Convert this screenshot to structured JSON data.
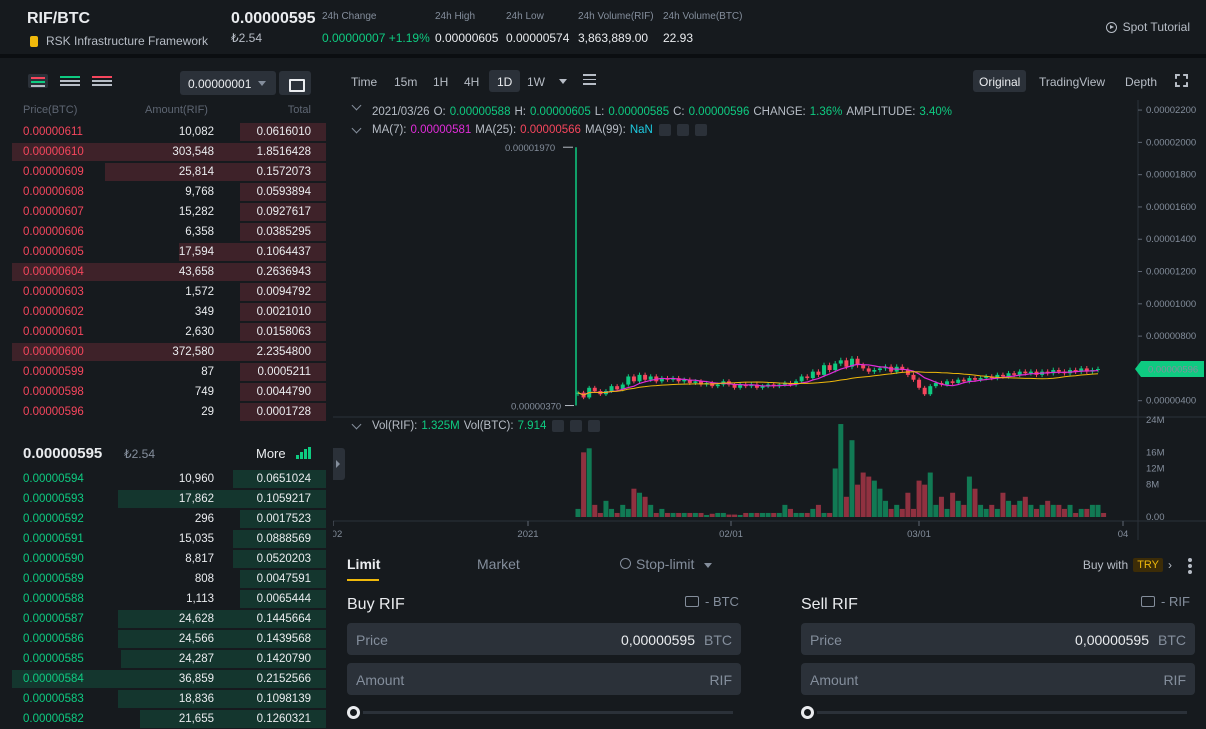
{
  "header": {
    "symbol": "RIF/BTC",
    "name": "RSK Infrastructure Framework",
    "last_price": "0.00000595",
    "last_fiat": "₺2.54",
    "stats": [
      {
        "label": "24h Change",
        "value": "0.00000007 +1.19%",
        "color": "green"
      },
      {
        "label": "24h High",
        "value": "0.00000605",
        "color": "white"
      },
      {
        "label": "24h Low",
        "value": "0.00000574",
        "color": "white"
      },
      {
        "label": "24h Volume(RIF)",
        "value": "3,863,889.00",
        "color": "white"
      },
      {
        "label": "24h Volume(BTC)",
        "value": "22.93",
        "color": "white"
      }
    ],
    "spot_tutorial": "Spot Tutorial"
  },
  "orderbook": {
    "tick_size": "0.00000001",
    "col_price": "Price(BTC)",
    "col_amount": "Amount(RIF)",
    "col_total": "Total",
    "asks": [
      {
        "price": "0.00000611",
        "amount": "10,082",
        "total": "0.0616010",
        "depth": 0.27
      },
      {
        "price": "0.00000610",
        "amount": "303,548",
        "total": "1.8516428",
        "depth": 0.98
      },
      {
        "price": "0.00000609",
        "amount": "25,814",
        "total": "0.1572073",
        "depth": 0.69
      },
      {
        "price": "0.00000608",
        "amount": "9,768",
        "total": "0.0593894",
        "depth": 0.27
      },
      {
        "price": "0.00000607",
        "amount": "15,282",
        "total": "0.0927617",
        "depth": 0.27
      },
      {
        "price": "0.00000606",
        "amount": "6,358",
        "total": "0.0385295",
        "depth": 0.27
      },
      {
        "price": "0.00000605",
        "amount": "17,594",
        "total": "0.1064437",
        "depth": 0.46
      },
      {
        "price": "0.00000604",
        "amount": "43,658",
        "total": "0.2636943",
        "depth": 0.98
      },
      {
        "price": "0.00000603",
        "amount": "1,572",
        "total": "0.0094792",
        "depth": 0.27
      },
      {
        "price": "0.00000602",
        "amount": "349",
        "total": "0.0021010",
        "depth": 0.27
      },
      {
        "price": "0.00000601",
        "amount": "2,630",
        "total": "0.0158063",
        "depth": 0.27
      },
      {
        "price": "0.00000600",
        "amount": "372,580",
        "total": "2.2354800",
        "depth": 0.98
      },
      {
        "price": "0.00000599",
        "amount": "87",
        "total": "0.0005211",
        "depth": 0.27
      },
      {
        "price": "0.00000598",
        "amount": "749",
        "total": "0.0044790",
        "depth": 0.27
      },
      {
        "price": "0.00000596",
        "amount": "29",
        "total": "0.0001728",
        "depth": 0.27
      }
    ],
    "mid_price": "0.00000595",
    "mid_fiat": "₺2.54",
    "more": "More",
    "bids": [
      {
        "price": "0.00000594",
        "amount": "10,960",
        "total": "0.0651024",
        "depth": 0.29
      },
      {
        "price": "0.00000593",
        "amount": "17,862",
        "total": "0.1059217",
        "depth": 0.65
      },
      {
        "price": "0.00000592",
        "amount": "296",
        "total": "0.0017523",
        "depth": 0.27
      },
      {
        "price": "0.00000591",
        "amount": "15,035",
        "total": "0.0888569",
        "depth": 0.29
      },
      {
        "price": "0.00000590",
        "amount": "8,817",
        "total": "0.0520203",
        "depth": 0.29
      },
      {
        "price": "0.00000589",
        "amount": "808",
        "total": "0.0047591",
        "depth": 0.27
      },
      {
        "price": "0.00000588",
        "amount": "1,113",
        "total": "0.0065444",
        "depth": 0.27
      },
      {
        "price": "0.00000587",
        "amount": "24,628",
        "total": "0.1445664",
        "depth": 0.65
      },
      {
        "price": "0.00000586",
        "amount": "24,566",
        "total": "0.1439568",
        "depth": 0.65
      },
      {
        "price": "0.00000585",
        "amount": "24,287",
        "total": "0.1420790",
        "depth": 0.64
      },
      {
        "price": "0.00000584",
        "amount": "36,859",
        "total": "0.2152566",
        "depth": 0.98
      },
      {
        "price": "0.00000583",
        "amount": "18,836",
        "total": "0.1098139",
        "depth": 0.65
      },
      {
        "price": "0.00000582",
        "amount": "21,655",
        "total": "0.1260321",
        "depth": 0.58
      }
    ]
  },
  "chart": {
    "intervals": [
      "Time",
      "15m",
      "1H",
      "4H",
      "1D",
      "1W"
    ],
    "active_interval": "1D",
    "views": [
      "Original",
      "TradingView",
      "Depth"
    ],
    "ohlc": {
      "date": "2021/03/26",
      "o_label": "O:",
      "o": "0.00000588",
      "h_label": "H:",
      "h": "0.00000605",
      "l_label": "L:",
      "l": "0.00000585",
      "c_label": "C:",
      "c": "0.00000596",
      "change_label": "CHANGE:",
      "change": "1.36%",
      "amp_label": "AMPLITUDE:",
      "amp": "3.40%"
    },
    "ma": {
      "ma7_label": "MA(7):",
      "ma7": "0.00000581",
      "ma25_label": "MA(25):",
      "ma25": "0.00000566",
      "ma99_label": "MA(99):",
      "ma99": "NaN"
    },
    "vol": {
      "rif_label": "Vol(RIF):",
      "rif": "1.325M",
      "btc_label": "Vol(BTC):",
      "btc": "7.914"
    },
    "price_axis": [
      "0.00002200",
      "0.00002000",
      "0.00001800",
      "0.00001600",
      "0.00001400",
      "0.00001200",
      "0.00001000",
      "0.00000800",
      "0.00000600",
      "0.00000400"
    ],
    "vol_axis": [
      "24M",
      "16M",
      "12M",
      "8M",
      "0.00"
    ],
    "time_axis": [
      "2/02",
      "2021",
      "02/01",
      "03/01",
      "04"
    ],
    "high_marker": "0.00001970",
    "low_marker": "0.00000370",
    "last_tag": "0.00000596",
    "colors": {
      "up": "#0ecb81",
      "down": "#f6465d",
      "ma7": "#f0b90b",
      "ma25": "#e12cd9"
    }
  },
  "chart_data": {
    "type": "candlestick",
    "title": "",
    "ylabel": "",
    "ylim": [
      3.3e-06,
      2.25e-05
    ],
    "volume_ylim": [
      0,
      24000000
    ],
    "x_ticks": [
      "2/02",
      "2021",
      "02/01",
      "03/01",
      "04"
    ],
    "series": [
      {
        "name": "MA(7)",
        "last": 5.81e-06
      },
      {
        "name": "MA(25)",
        "last": 5.66e-06
      }
    ],
    "extremes": {
      "high": 1.97e-05,
      "low": 3.7e-06,
      "last": 5.96e-06
    },
    "close": [
      4.5e-06,
      4.2e-06,
      4.8e-06,
      4.6e-06,
      4.4e-06,
      4.6e-06,
      4.9e-06,
      4.7e-06,
      5e-06,
      5.5e-06,
      5.2e-06,
      5.6e-06,
      5.3e-06,
      5.5e-06,
      5.2e-06,
      5.4e-06,
      5.3e-06,
      5.4e-06,
      5.2e-06,
      5.3e-06,
      5.1e-06,
      5.2e-06,
      5e-06,
      5.1e-06,
      4.9e-06,
      5e-06,
      5.2e-06,
      5e-06,
      4.8e-06,
      5e-06,
      4.9e-06,
      5e-06,
      4.8e-06,
      4.9e-06,
      5e-06,
      4.9e-06,
      5e-06,
      5.1e-06,
      5e-06,
      5.2e-06,
      5.5e-06,
      5.4e-06,
      5.8e-06,
      5.6e-06,
      6.2e-06,
      5.9e-06,
      6.3e-06,
      6.5e-06,
      6.1e-06,
      6.6e-06,
      6.2e-06,
      6e-06,
      5.8e-06,
      5.9e-06,
      6e-06,
      6.1e-06,
      5.8e-06,
      6.1e-06,
      5.9e-06,
      5.6e-06,
      5.3e-06,
      4.8e-06,
      4.4e-06,
      4.9e-06,
      5.1e-06,
      5e-06,
      5.2e-06,
      5.1e-06,
      5.3e-06,
      5.2e-06,
      5.4e-06,
      5.3e-06,
      5.4e-06,
      5.5e-06,
      5.4e-06,
      5.6e-06,
      5.5e-06,
      5.7e-06,
      5.6e-06,
      5.8e-06,
      5.7e-06,
      5.8e-06,
      5.6e-06,
      5.8e-06,
      5.7e-06,
      5.9e-06,
      5.8e-06,
      5.7e-06,
      5.9e-06,
      5.8e-06,
      6e-06,
      5.8e-06,
      5.9e-06,
      5.96e-06
    ],
    "volume_m": [
      2,
      16,
      17,
      3,
      1,
      4,
      2,
      1,
      3,
      2,
      7,
      6,
      5,
      3,
      1,
      2,
      1,
      1,
      1,
      1,
      1,
      1,
      1,
      0.5,
      0.8,
      1,
      1,
      0.6,
      0.6,
      0.5,
      1,
      1,
      1,
      1,
      1,
      1,
      1,
      3,
      2,
      1,
      1,
      1,
      2,
      3,
      1,
      1,
      12,
      23,
      5,
      19,
      8,
      11,
      10,
      9,
      7,
      4,
      2,
      3,
      2,
      6,
      2,
      9,
      8,
      11,
      3,
      5,
      2,
      6,
      4,
      3,
      10,
      7,
      3,
      2,
      3,
      2,
      6,
      4,
      3,
      4,
      5,
      3,
      2,
      3,
      4,
      3,
      3,
      2,
      3,
      1,
      2,
      2,
      3,
      3,
      1
    ]
  },
  "trade": {
    "tabs": [
      "Limit",
      "Market",
      "Stop-limit"
    ],
    "buy_with": "Buy with",
    "buy_with_currency": "TRY",
    "buy": {
      "title": "Buy RIF",
      "balance": "- BTC",
      "price_label": "Price",
      "price": "0,00000595",
      "price_unit": "BTC",
      "amount_label": "Amount",
      "amount_unit": "RIF"
    },
    "sell": {
      "title": "Sell RIF",
      "balance": "- RIF",
      "price_label": "Price",
      "price": "0,00000595",
      "price_unit": "BTC",
      "amount_label": "Amount",
      "amount_unit": "RIF"
    }
  }
}
